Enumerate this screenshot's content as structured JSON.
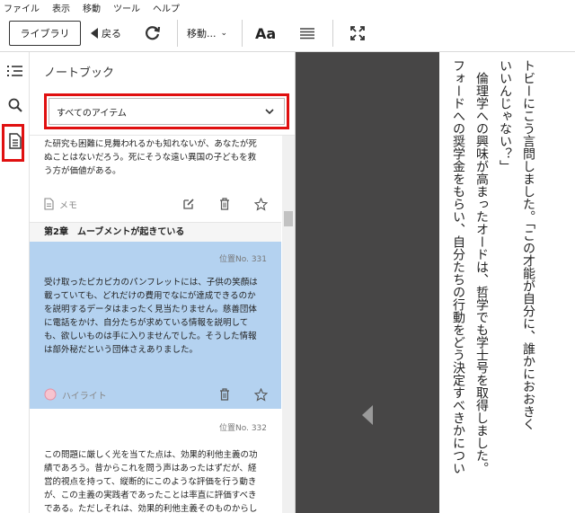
{
  "menu": [
    "ファイル",
    "表示",
    "移動",
    "ツール",
    "ヘルプ"
  ],
  "toolbar": {
    "library": "ライブラリ",
    "back": "戻る",
    "goto": "移動...",
    "font": "Aa"
  },
  "notebook": {
    "title": "ノートブック",
    "filter_value": "すべてのアイテム",
    "note": {
      "text": "た研究も困難に見舞われるかも知れないが、あなたが死ぬことはないだろう。死にそうな遠い異国の子どもを救う方が価値がある。",
      "type_label": "メモ"
    },
    "chapter": "第2章　ムーブメントが起きている",
    "highlight": {
      "position": "位置No. 331",
      "text": "受け取ったピカピカのパンフレットには、子供の笑顔は載っていても、どれだけの費用でなにが達成できるのかを説明するデータはまったく見当たりません。慈善団体に電話をかけ、自分たちが求めている情報を説明しても、欲しいものは手に入りませんでした。そうした情報は部外秘だという団体さえありました。",
      "type_label": "ハイライト"
    },
    "item3": {
      "position": "位置No. 332",
      "text": "この問題に厳しく光を当てた点は、効果的利他主義の功績であろう。昔からこれを問う声はあったはずだが、経営的視点を持って、縦断的にこのような評価を行う動きが、この主義の実践者であったことは率直に評価すべきである。ただしそれは、効果的利他主義そのものからしか導けない問題"
    }
  },
  "reader": {
    "columns": [
      "フォードへの奨学金をもらい、自分たちの行動をどう決定すべきかについ",
      "　倫理学への興味が高まったオードは、哲学でも学士号を取得しました。",
      "いいんじゃない？」",
      "トビーにこう言問しました。「この才能が自分に、誰かにおおきく"
    ]
  }
}
